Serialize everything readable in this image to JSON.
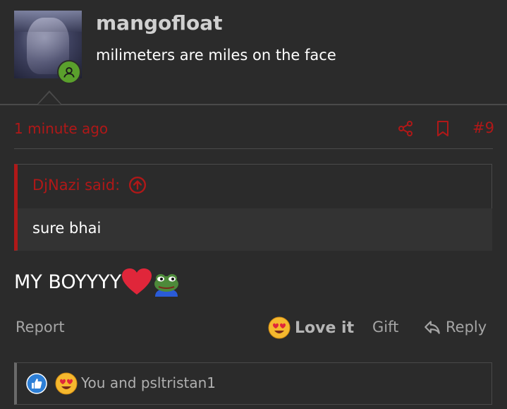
{
  "post_header": {
    "username": "mangofloat",
    "user_title": "milimeters are miles on the face"
  },
  "meta": {
    "timestamp": "1 minute ago",
    "post_number": "#9"
  },
  "quote": {
    "author_said": "DjNazi said:",
    "text": "sure bhai"
  },
  "message": {
    "text": "MY BOYYYY"
  },
  "actions": {
    "report": "Report",
    "love": "Love it",
    "gift": "Gift",
    "reply": "Reply"
  },
  "reactions": {
    "summary": "You and psltristan1"
  },
  "colors": {
    "accent_red": "#b01818",
    "background": "#2b2b2b",
    "online_green": "#5aa02c",
    "like_blue": "#2d7fd6"
  },
  "icons": [
    "online-status-icon",
    "share-icon",
    "bookmark-icon",
    "quote-jump-icon",
    "heart-emoji-icon",
    "pepe-emoji-icon",
    "love-reaction-icon",
    "reply-icon",
    "like-reaction-icon"
  ]
}
